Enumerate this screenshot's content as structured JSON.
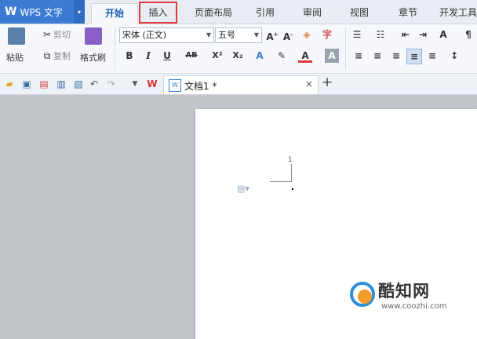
{
  "app": {
    "logo": "W",
    "name": "WPS 文字",
    "menu_arrow": "▾"
  },
  "tabs": [
    {
      "label": "开始"
    },
    {
      "label": "插入"
    },
    {
      "label": "页面布局"
    },
    {
      "label": "引用"
    },
    {
      "label": "审阅"
    },
    {
      "label": "视图"
    },
    {
      "label": "章节"
    },
    {
      "label": "开发工具"
    }
  ],
  "ribbon": {
    "paste_label": "粘贴",
    "cut_label": "剪切",
    "copy_label": "复制",
    "format_painter_label": "格式刷",
    "font_name": "宋体 (正文)",
    "font_size": "五号",
    "bold": "B",
    "italic": "I",
    "underline": "U",
    "strikethrough": "AB",
    "superscript": "X²",
    "subscript": "X₂",
    "font_color_letter": "A"
  },
  "document_tab": {
    "title": "文档1 *",
    "close": "×",
    "new": "+"
  },
  "page": {
    "page_number": "1"
  },
  "watermark": {
    "title": "酷知网",
    "url": "www.coozhi.com"
  },
  "colors": {
    "accent": "#3b7bd4",
    "highlight": "#e03a3a"
  }
}
